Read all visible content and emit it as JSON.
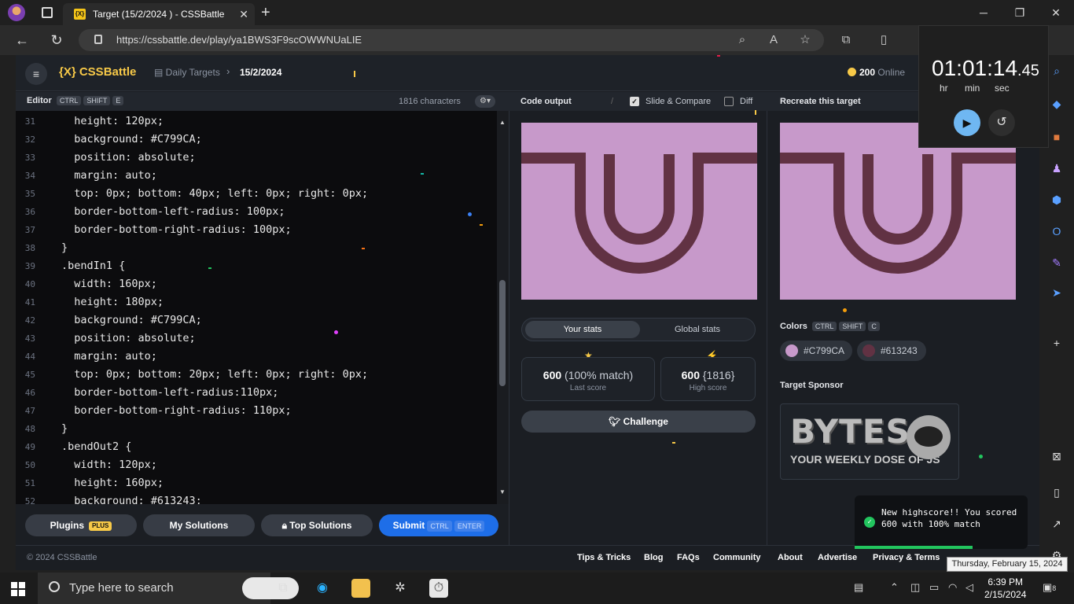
{
  "browser": {
    "tab_title": "Target (15/2/2024 ) - CSSBattle",
    "tab_favicon": "{X}",
    "url": "https://cssbattle.dev/play/ya1BWS3F9scOWWNUaLIE"
  },
  "header": {
    "logo": "{X} CSSBattle",
    "breadcrumb_1": "Daily Targets",
    "breadcrumb_2": "15/2/2024",
    "online_count": "200",
    "online_label": "Online"
  },
  "editor": {
    "title": "Editor",
    "keys": [
      "CTRL",
      "SHIFT",
      "E"
    ],
    "char_count": "1816 characters",
    "lines": [
      {
        "n": "31",
        "t": "  height: 120px;"
      },
      {
        "n": "32",
        "t": "  background: #C799CA;"
      },
      {
        "n": "33",
        "t": "  position: absolute;"
      },
      {
        "n": "34",
        "t": "  margin: auto;"
      },
      {
        "n": "35",
        "t": "  top: 0px; bottom: 40px; left: 0px; right: 0px;"
      },
      {
        "n": "36",
        "t": "  border-bottom-left-radius: 100px;"
      },
      {
        "n": "37",
        "t": "  border-bottom-right-radius: 100px;"
      },
      {
        "n": "38",
        "t": "}"
      },
      {
        "n": "39",
        "t": ".bendIn1 {"
      },
      {
        "n": "40",
        "t": "  width: 160px;"
      },
      {
        "n": "41",
        "t": "  height: 180px;"
      },
      {
        "n": "42",
        "t": "  background: #C799CA;"
      },
      {
        "n": "43",
        "t": "  position: absolute;"
      },
      {
        "n": "44",
        "t": "  margin: auto;"
      },
      {
        "n": "45",
        "t": "  top: 0px; bottom: 20px; left: 0px; right: 0px;"
      },
      {
        "n": "46",
        "t": "  border-bottom-left-radius:110px;"
      },
      {
        "n": "47",
        "t": "  border-bottom-right-radius: 110px;"
      },
      {
        "n": "48",
        "t": "}"
      },
      {
        "n": "49",
        "t": ".bendOut2 {"
      },
      {
        "n": "50",
        "t": "  width: 120px;"
      },
      {
        "n": "51",
        "t": "  height: 160px;"
      },
      {
        "n": "52",
        "t": "  background: #613243;"
      }
    ],
    "buttons": {
      "plugins": "Plugins",
      "plugins_tag": "PLUS",
      "my_solutions": "My Solutions",
      "top_solutions": "Top Solutions",
      "submit": "Submit",
      "submit_k1": "CTRL",
      "submit_k2": "ENTER"
    }
  },
  "output": {
    "title": "Code output",
    "slide_compare": "Slide & Compare",
    "diff": "Diff",
    "your_stats": "Your stats",
    "global_stats": "Global stats",
    "last_score_value": "600",
    "last_score_match": "(100% match)",
    "last_score_label": "Last score",
    "high_score_value": "600",
    "high_score_chars": "{1816}",
    "high_score_label": "High score",
    "challenge": "Challenge"
  },
  "target": {
    "title": "Recreate this target",
    "colors_label": "Colors",
    "colors_keys": [
      "CTRL",
      "SHIFT",
      "C"
    ],
    "colors": [
      {
        "hex": "#C799CA"
      },
      {
        "hex": "#613243"
      }
    ],
    "sponsor_label": "Target Sponsor",
    "sponsor_text_1": "BYTES",
    "sponsor_text_2": "YOUR WEEKLY DOSE OF JS"
  },
  "toast": {
    "message": "New highscore!! You scored 600 with 100% match"
  },
  "footer": {
    "copyright": "© 2024 CSSBattle",
    "links": [
      "Tips & Tricks",
      "Blog",
      "FAQs",
      "Community",
      "About",
      "Advertise",
      "Privacy & Terms"
    ]
  },
  "tooltip": "Thursday, February 15, 2024",
  "timer": {
    "hours": "01",
    "minutes": "01",
    "seconds": "14",
    "fraction": ".45",
    "hr": "hr",
    "min": "min",
    "sec": "sec"
  },
  "taskbar": {
    "search_placeholder": "Type here to search",
    "time": "6:39 PM",
    "date": "2/15/2024",
    "notifications": "8"
  },
  "colors": {
    "accent": "#f7c948",
    "target_bg": "#C799CA",
    "target_fg": "#613243",
    "submit_blue": "#1e6ee8"
  }
}
